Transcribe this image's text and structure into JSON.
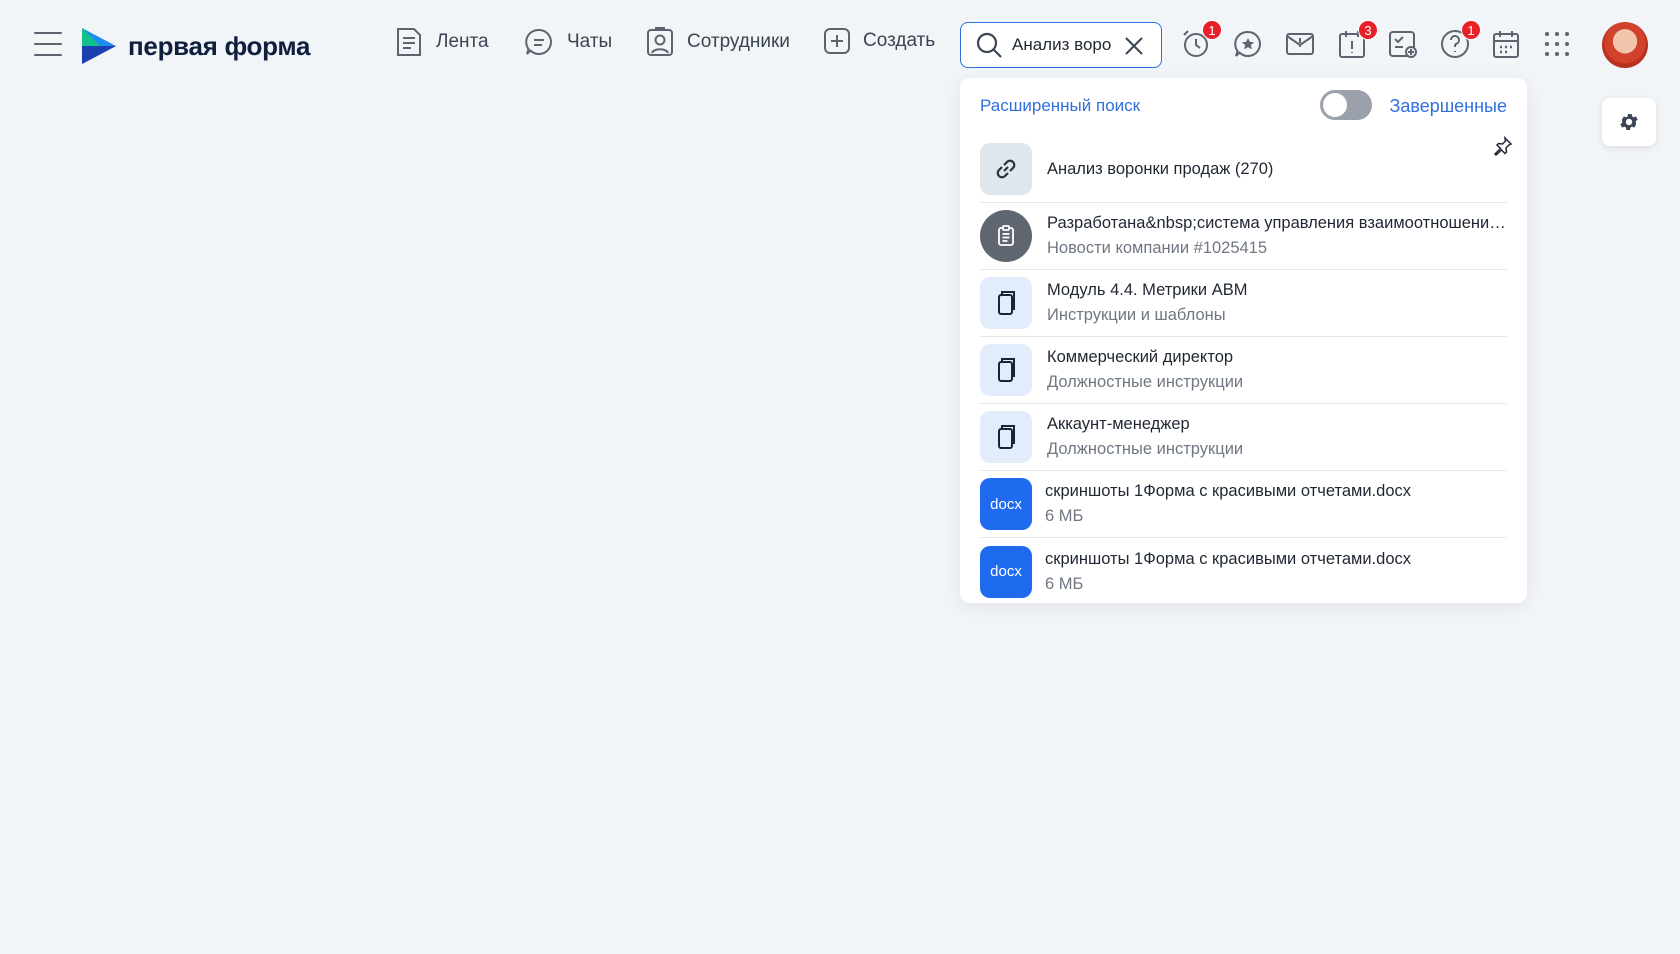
{
  "app": {
    "logo_text": "первая форма"
  },
  "nav": {
    "feed_label": "Лента",
    "chats_label": "Чаты",
    "employees_label": "Сотрудники",
    "create_label": "Создать"
  },
  "search": {
    "value": "Анализ воронки"
  },
  "badges": {
    "reminders": "1",
    "alerts": "3",
    "help": "1"
  },
  "dropdown": {
    "advanced_search": "Расширенный поиск",
    "completed_label": "Завершенные",
    "completed_toggle_on": false,
    "results": [
      {
        "icon": "link-icon",
        "title": "Анализ воронки продаж (270)",
        "subtitle": ""
      },
      {
        "icon": "clipboard-icon",
        "title": "Разработана&nbsp;система управления взаимоотношениями с клиентами",
        "subtitle": "Новости компании #1025415"
      },
      {
        "icon": "document-icon",
        "title": "Модуль 4.4. Метрики ABM",
        "subtitle": "Инструкции и шаблоны"
      },
      {
        "icon": "document-icon",
        "title": "Коммерческий директор",
        "subtitle": "Должностные инструкции"
      },
      {
        "icon": "document-icon",
        "title": "Аккаунт-менеджер",
        "subtitle": "Должностные инструкции"
      },
      {
        "icon": "docx-file-icon",
        "badge": "docx",
        "title": "скриншоты 1Форма с красивыми отчетами.docx",
        "subtitle": "6 МБ"
      },
      {
        "icon": "docx-file-icon",
        "badge": "docx",
        "title": "скриншоты 1Форма с красивыми отчетами.docx",
        "subtitle": "6 МБ"
      }
    ]
  },
  "colors": {
    "accent": "#2f6fe0",
    "background": "#f2f5f8",
    "badge": "#e8202a",
    "docx": "#1f6bf0"
  }
}
